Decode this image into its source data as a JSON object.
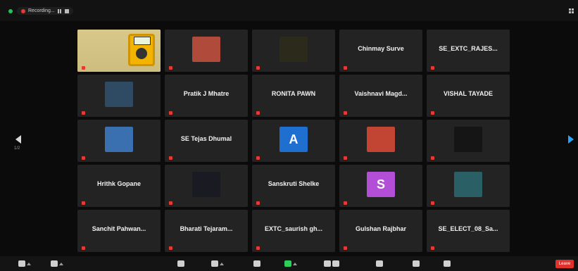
{
  "topbar": {
    "recording_label": "Recording..."
  },
  "tiles": [
    {
      "name": "",
      "tag": "",
      "type": "meter"
    },
    {
      "name": "",
      "tag": "",
      "type": "photo",
      "color": "#b04a3a"
    },
    {
      "name": "",
      "tag": "",
      "type": "photo",
      "color": "#2c2a1a"
    },
    {
      "name": "Chinmay Surve",
      "tag": "",
      "type": "text"
    },
    {
      "name": "SE_EXTC_RAJES...",
      "tag": "",
      "type": "text"
    },
    {
      "name": "",
      "tag": "",
      "type": "photo",
      "color": "#2f4a63"
    },
    {
      "name": "Pratik J Mhatre",
      "tag": "",
      "type": "text"
    },
    {
      "name": "RONITA PAWN",
      "tag": "",
      "type": "text"
    },
    {
      "name": "Vaishnavi Magd...",
      "tag": "",
      "type": "text"
    },
    {
      "name": "VISHAL TAYADE",
      "tag": "",
      "type": "text"
    },
    {
      "name": "",
      "tag": "",
      "type": "photo",
      "color": "#3a6fb0"
    },
    {
      "name": "SE Tejas Dhumal",
      "tag": "",
      "type": "text"
    },
    {
      "name": "",
      "tag": "",
      "type": "avatar",
      "letter": "A",
      "color": "#1f6fd1"
    },
    {
      "name": "",
      "tag": "",
      "type": "photo",
      "color": "#c24432"
    },
    {
      "name": "",
      "tag": "",
      "type": "photo",
      "color": "#151515"
    },
    {
      "name": "Hrithk Gopane",
      "tag": "",
      "type": "text"
    },
    {
      "name": "",
      "tag": "",
      "type": "photo",
      "color": "#1a1a22"
    },
    {
      "name": "Sanskruti Shelke",
      "tag": "",
      "type": "text"
    },
    {
      "name": "",
      "tag": "",
      "type": "avatar",
      "letter": "S",
      "color": "#b24fd6"
    },
    {
      "name": "",
      "tag": "",
      "type": "photo",
      "color": "#2b5f66"
    },
    {
      "name": "Sanchit Pahwan...",
      "tag": "",
      "type": "text"
    },
    {
      "name": "Bharati Tejaram...",
      "tag": "",
      "type": "text"
    },
    {
      "name": "EXTC_saurish gh...",
      "tag": "",
      "type": "text"
    },
    {
      "name": "Gulshan Rajbhar",
      "tag": "",
      "type": "text"
    },
    {
      "name": "SE_ELECT_08_Sa...",
      "tag": "",
      "type": "text"
    }
  ],
  "nav": {
    "left_page": "1/2",
    "right_page": ""
  },
  "toolbar": {
    "end_label": "Leave"
  }
}
